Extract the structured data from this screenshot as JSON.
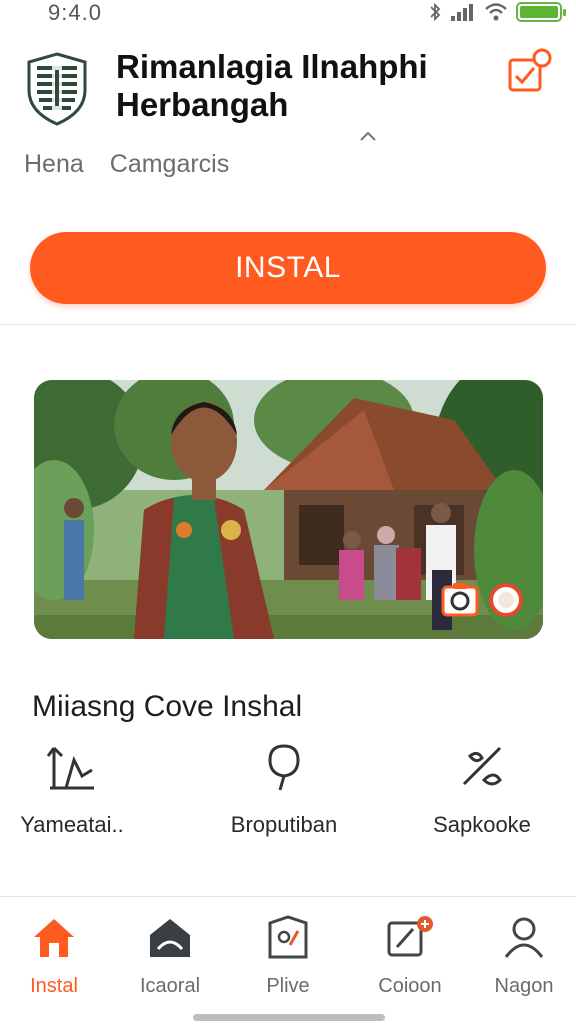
{
  "status_bar": {
    "time": "9:4.0",
    "battery_level": 1.0
  },
  "header": {
    "title": "Rimanlagia Ilnahphi Herbangah",
    "logo_icon": "shield-logo-icon",
    "action_icon": "checklist-notification-icon"
  },
  "tabs": [
    {
      "label": "Hena"
    },
    {
      "label": "Camgarcis"
    }
  ],
  "install_button": {
    "label": "INSTAL"
  },
  "hero": {
    "badge_icons": [
      "camera-icon",
      "record-icon"
    ]
  },
  "section": {
    "title": "Miiasng Cove Inshal"
  },
  "features": [
    {
      "label": "Yameatai..",
      "icon": "chart-icon"
    },
    {
      "label": "Broputiban",
      "icon": "tree-icon"
    },
    {
      "label": "Sapkooke",
      "icon": "edit-icon"
    }
  ],
  "bottom_nav": [
    {
      "label": "Instal",
      "icon": "home-icon",
      "active": true
    },
    {
      "label": "Icaoral",
      "icon": "house-icon",
      "active": false
    },
    {
      "label": "Plive",
      "icon": "map-icon",
      "active": false
    },
    {
      "label": "Coioon",
      "icon": "compose-icon",
      "active": false
    },
    {
      "label": "Nagon",
      "icon": "profile-icon",
      "active": false
    }
  ],
  "colors": {
    "accent": "#ff5a1f",
    "battery": "#5cb531",
    "logo": "#2f4a3a"
  }
}
